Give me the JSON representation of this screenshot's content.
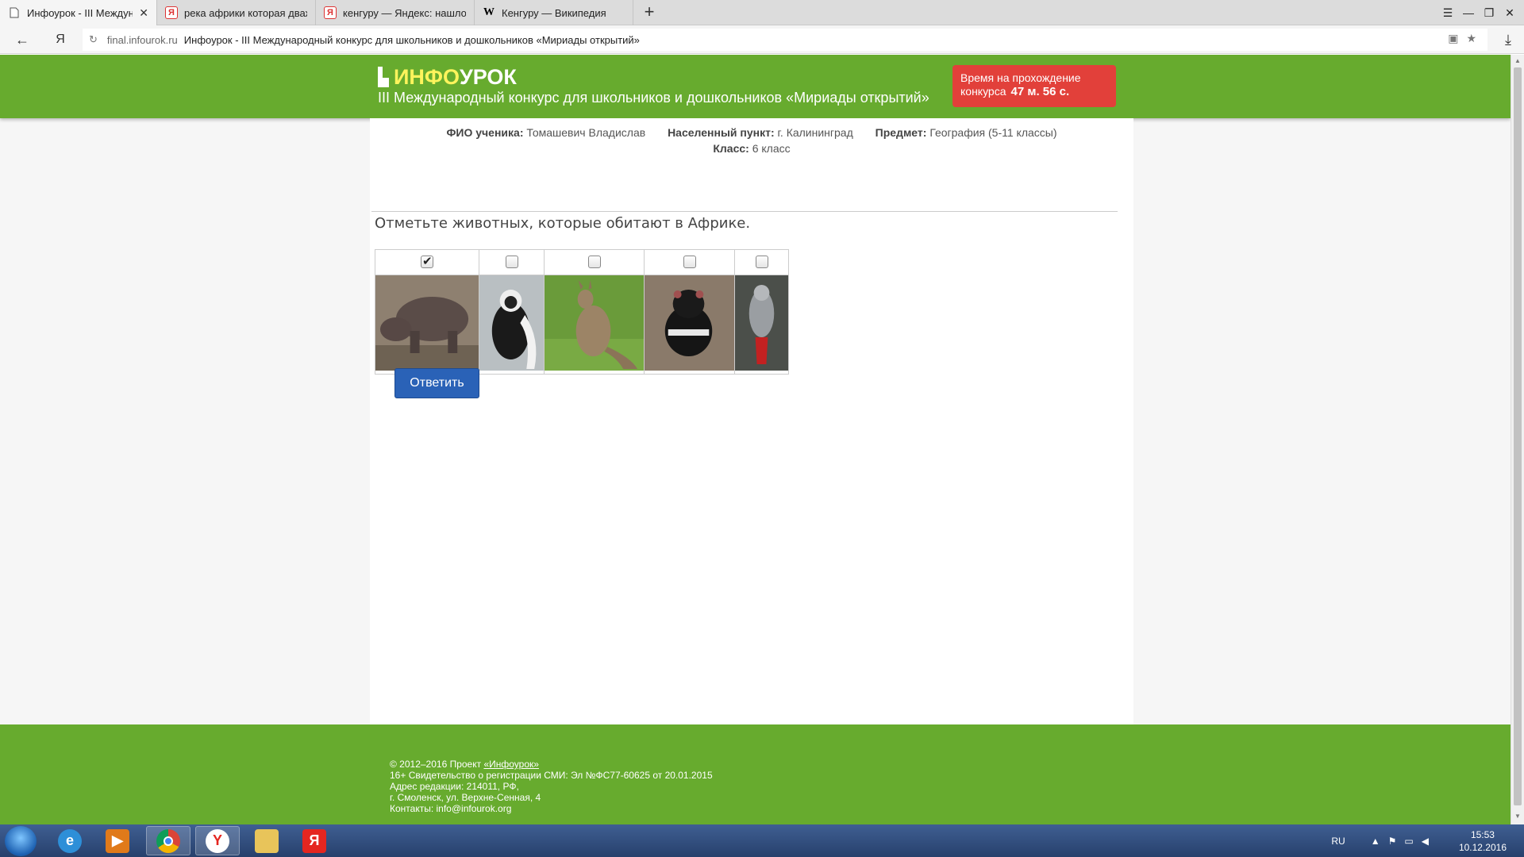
{
  "browser": {
    "tabs": [
      {
        "title": "Инфоурок - III Междуна",
        "icon": "page-icon",
        "active": true
      },
      {
        "title": "река африки которая дваж",
        "icon": "yandex-icon",
        "active": false
      },
      {
        "title": "кенгуру — Яндекс: нашлос",
        "icon": "yandex-icon",
        "active": false
      },
      {
        "title": "Кенгуру — Википедия",
        "icon": "wikipedia-icon",
        "active": false
      }
    ],
    "tab_close": "✕",
    "new_tab": "+",
    "back": "←",
    "yandex_button": "Я",
    "url_domain": "final.infourok.ru",
    "url_title": "Инфоурок - III Международный конкурс для школьников и дошкольников «Мириады открытий»",
    "menu": "☰",
    "minimize": "—",
    "restore": "❐",
    "close": "✕",
    "download": "⤓"
  },
  "header": {
    "logo_part1": "ИНФО",
    "logo_part2": "УРОК",
    "contest_title": "III Международный конкурс для школьников и дошкольников «Мириады открытий»",
    "timer_label_line1": "Время на прохождение",
    "timer_label_line2": "конкурса",
    "timer_value": "47 м. 56 с."
  },
  "student": {
    "name_label": "ФИО ученика:",
    "name": "Томашевич Владислав",
    "city_label": "Населенный пункт:",
    "city": "г. Калининград",
    "subject_label": "Предмет:",
    "subject": "География (5-11 классы)",
    "grade_label": "Класс:",
    "grade": "6 класс"
  },
  "question": {
    "text": "Отметьте животных, которые обитают в Африке.",
    "options": [
      {
        "animal": "hippo",
        "checked": true
      },
      {
        "animal": "colobus",
        "checked": false
      },
      {
        "animal": "kangaroo",
        "checked": false
      },
      {
        "animal": "tasmanian-devil",
        "checked": false
      },
      {
        "animal": "grey-parrot",
        "checked": false
      }
    ],
    "answer_button": "Ответить"
  },
  "footer": {
    "copyright_prefix": "© 2012–2016 Проект ",
    "copyright_link": "«Инфоурок»",
    "line2": "16+ Свидетельство о регистрации СМИ: Эл №ФС77-60625 от 20.01.2015",
    "line3": "Адрес редакции: 214011, РФ,",
    "line4": "г. Смоленск, ул. Верхне-Сенная, 4",
    "line5": "Контакты: info@infourok.org"
  },
  "taskbar": {
    "lang": "RU",
    "time": "15:53",
    "date": "10.12.2016",
    "yandex_browser_label": "Y",
    "yandex_label": "Я"
  }
}
